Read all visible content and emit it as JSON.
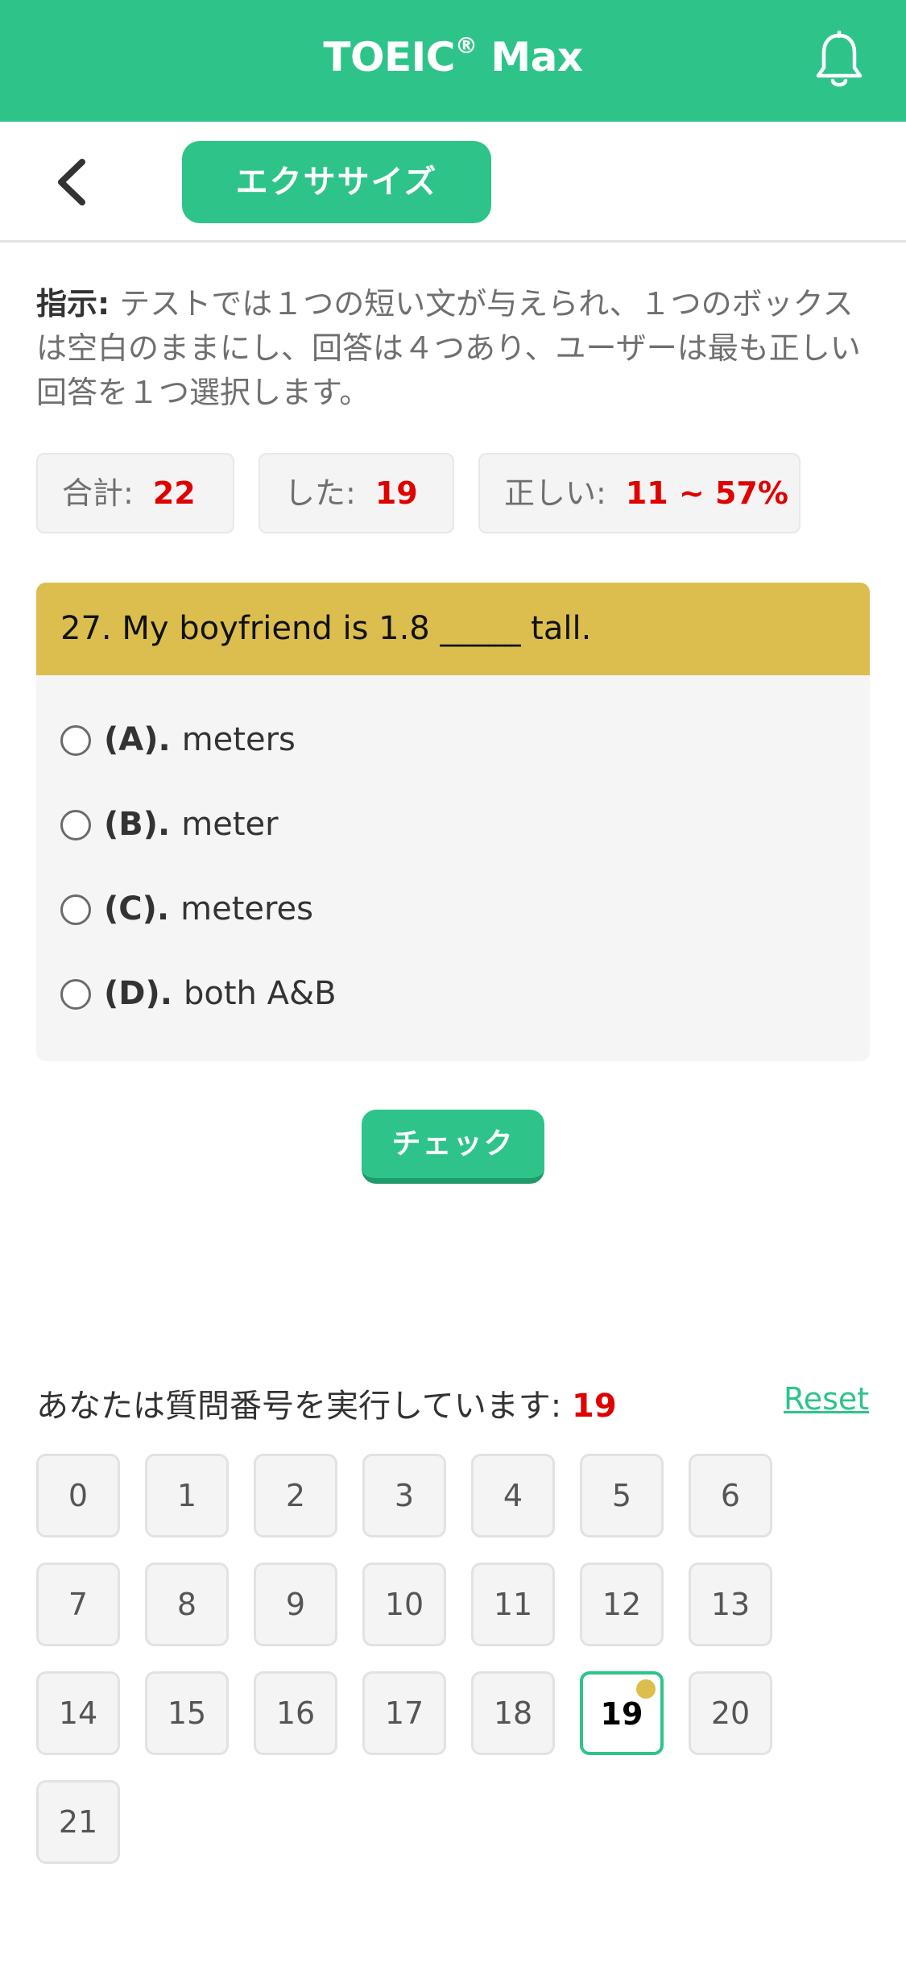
{
  "header": {
    "title": "TOEIC",
    "title_mark": "®",
    "title_suffix": " Max",
    "bell_icon": "bell-icon"
  },
  "subbar": {
    "back_icon": "chevron-left-icon",
    "exercise_label": "エクササイズ"
  },
  "instructions": {
    "label": "指示:",
    "text": " テストでは１つの短い文が与えられ、１つのボックスは空白のままにし、回答は４つあり、ユーザーは最も正しい回答を１つ選択します。"
  },
  "stats": {
    "total_label": "合計:",
    "total_value": "22",
    "done_label": "した:",
    "done_value": "19",
    "correct_label": "正しい:",
    "correct_value": "11 ~ 57%"
  },
  "question": {
    "text": "27. My boyfriend is 1.8 _____ tall.",
    "options": [
      {
        "letter": "(A).",
        "text": "meters"
      },
      {
        "letter": "(B).",
        "text": "meter"
      },
      {
        "letter": "(C).",
        "text": "meteres"
      },
      {
        "letter": "(D).",
        "text": "both A&B"
      }
    ]
  },
  "check_label": "チェック",
  "progress": {
    "running_label": "あなたは質問番号を実行しています:",
    "current": "19",
    "reset_label": "Reset",
    "numbers": [
      "0",
      "1",
      "2",
      "3",
      "4",
      "5",
      "6",
      "7",
      "8",
      "9",
      "10",
      "11",
      "12",
      "13",
      "14",
      "15",
      "16",
      "17",
      "18",
      "19",
      "20",
      "21"
    ]
  },
  "colors": {
    "accent": "#2ec489",
    "question_header": "#dbbe4e",
    "highlight_number": "#e00000"
  }
}
